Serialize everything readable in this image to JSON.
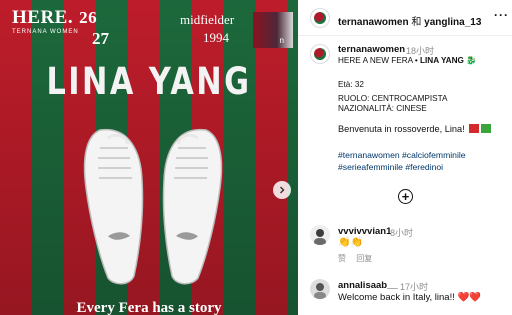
{
  "post_image": {
    "logo_here": "HERE.",
    "logo_year_top": "26",
    "logo_year_bottom": "27",
    "logo_club": "TERNANA WOMEN",
    "role": "midfielder",
    "year": "1994",
    "badge_letter": "n",
    "player_name": "LINA YANG",
    "tagline": "Every Fera has a story"
  },
  "header": {
    "account": "ternanawomen",
    "conjunction": "和",
    "collaborator": "yanglina_13",
    "more": "···"
  },
  "caption": {
    "username": "ternanawomen",
    "time": "18小时",
    "line1_prefix": "HERE A NEW FERA • ",
    "line1_name": "LINA YANG",
    "line1_emoji": "🐉",
    "age": "Età: 32",
    "role": "RUOLO: CENTROCAMPISTA",
    "nationality": "NAZIONALITÀ: CINESE",
    "welcome": "Benvenuta in rossoverde, Lina!",
    "hashtags_line1": "#ternanawomen #calciofemminile",
    "hashtags_line2": "#serieafemminile #feredinoi"
  },
  "comments": [
    {
      "username": "vvvivvvian1",
      "time": "8小时",
      "text": "👏👏",
      "actions": [
        "赞",
        "回复"
      ]
    },
    {
      "username": "annalisaab__",
      "time": "17小时",
      "text": "Welcome back in Italy, lina!!",
      "text_emoji": "❤️❤️"
    }
  ],
  "colors": {
    "red_stripe": "#c81e2c",
    "green_stripe": "#1e6e3f",
    "hashtag": "#00376b",
    "muted": "#8e8e8e"
  },
  "icons": [
    "next-arrow-icon",
    "add-comment-icon",
    "more-options-icon"
  ]
}
